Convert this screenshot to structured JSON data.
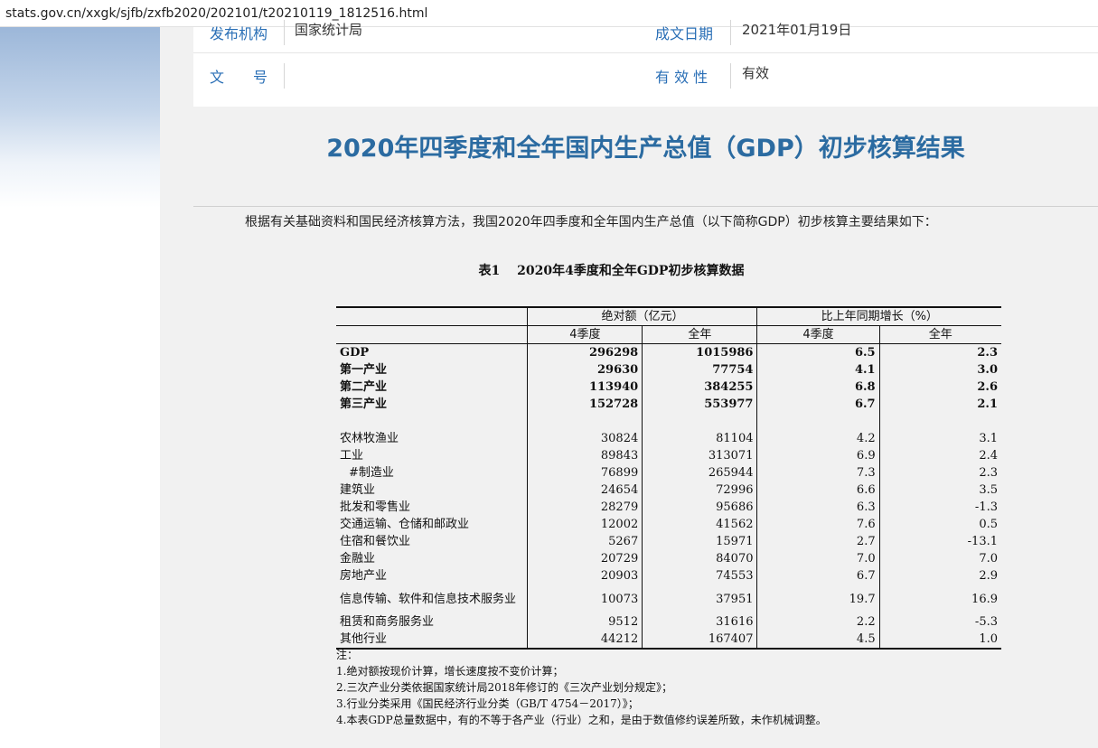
{
  "browser": {
    "url": "stats.gov.cn/xxgk/sjfb/zxfb2020/202101/t20210119_1812516.html"
  },
  "meta": {
    "publisher_label": "发布机构",
    "publisher_value": "国家统计局",
    "date_label": "成文日期",
    "date_value": "2021年01月19日",
    "docno_label": "文　　号",
    "docno_value": "",
    "validity_label": "有 效 性",
    "validity_value": "有效"
  },
  "article": {
    "title": "2020年四季度和全年国内生产总值（GDP）初步核算结果",
    "intro": "根据有关基础资料和国民经济核算方法，我国2020年四季度和全年国内生产总值（以下简称GDP）初步核算主要结果如下："
  },
  "table": {
    "title": "表1　 2020年4季度和全年GDP初步核算数据",
    "group_abs": "绝对额（亿元）",
    "group_growth": "比上年同期增长（%）",
    "sub_q4": "4季度",
    "sub_year": "全年",
    "rows": [
      {
        "name": "GDP",
        "q4": "296298",
        "year": "1015986",
        "gq4": "6.5",
        "gyear": "2.3"
      },
      {
        "name": "第一产业",
        "q4": "29630",
        "year": "77754",
        "gq4": "4.1",
        "gyear": "3.0"
      },
      {
        "name": "第二产业",
        "q4": "113940",
        "year": "384255",
        "gq4": "6.8",
        "gyear": "2.6"
      },
      {
        "name": "第三产业",
        "q4": "152728",
        "year": "553977",
        "gq4": "6.7",
        "gyear": "2.1"
      },
      {
        "name": "农林牧渔业",
        "q4": "30824",
        "year": "81104",
        "gq4": "4.2",
        "gyear": "3.1"
      },
      {
        "name": "工业",
        "q4": "89843",
        "year": "313071",
        "gq4": "6.9",
        "gyear": "2.4"
      },
      {
        "name": "#制造业",
        "q4": "76899",
        "year": "265944",
        "gq4": "7.3",
        "gyear": "2.3"
      },
      {
        "name": "建筑业",
        "q4": "24654",
        "year": "72996",
        "gq4": "6.6",
        "gyear": "3.5"
      },
      {
        "name": "批发和零售业",
        "q4": "28279",
        "year": "95686",
        "gq4": "6.3",
        "gyear": "-1.3"
      },
      {
        "name": "交通运输、仓储和邮政业",
        "q4": "12002",
        "year": "41562",
        "gq4": "7.6",
        "gyear": "0.5"
      },
      {
        "name": "住宿和餐饮业",
        "q4": "5267",
        "year": "15971",
        "gq4": "2.7",
        "gyear": "-13.1"
      },
      {
        "name": "金融业",
        "q4": "20729",
        "year": "84070",
        "gq4": "7.0",
        "gyear": "7.0"
      },
      {
        "name": "房地产业",
        "q4": "20903",
        "year": "74553",
        "gq4": "6.7",
        "gyear": "2.9"
      },
      {
        "name": "信息传输、软件和信息技术服务业",
        "q4": "10073",
        "year": "37951",
        "gq4": "19.7",
        "gyear": "16.9"
      },
      {
        "name": "租赁和商务服务业",
        "q4": "9512",
        "year": "31616",
        "gq4": "2.2",
        "gyear": "-5.3"
      },
      {
        "name": "其他行业",
        "q4": "44212",
        "year": "167407",
        "gq4": "4.5",
        "gyear": "1.0"
      }
    ],
    "notes": [
      "注：",
      "1.绝对额按现价计算，增长速度按不变价计算；",
      "2.三次产业分类依据国家统计局2018年修订的《三次产业划分规定》；",
      "3.行业分类采用《国民经济行业分类（GB/T 4754－2017）》；",
      "4.本表GDP总量数据中，有的不等于各产业（行业）之和，是由于数值修约误差所致，未作机械调整。"
    ]
  }
}
